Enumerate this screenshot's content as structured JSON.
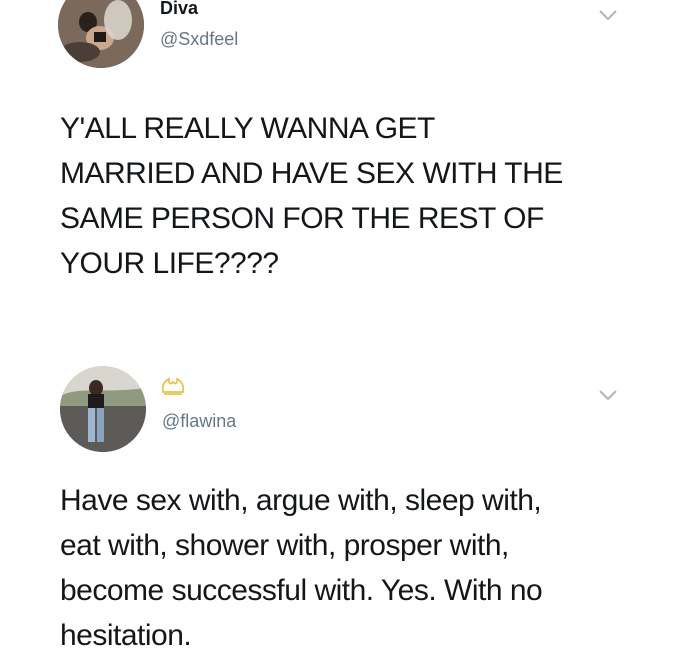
{
  "tweets": [
    {
      "display_name": "Diva",
      "handle": "@Sxdfeel",
      "text": "Y'ALL REALLY WANNA GET\nMARRIED AND HAVE SEX WITH THE\nSAME PERSON FOR THE REST OF\nYOUR LIFE????"
    },
    {
      "handle": "@flawina",
      "badge_icon": "crown-icon",
      "text": "Have sex with, argue with, sleep with,\neat with, shower with, prosper with,\nbecome successful with. Yes. With no\nhesitation."
    }
  ],
  "colors": {
    "text": "#14171a",
    "secondary_text": "#657786",
    "chevron": "#aab8c2",
    "crown": "#e8c34a"
  }
}
